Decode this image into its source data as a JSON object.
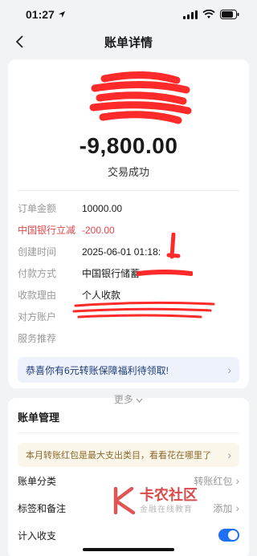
{
  "status_bar": {
    "time": "01:27"
  },
  "nav": {
    "title": "账单详情"
  },
  "summary": {
    "amount": "-9,800.00",
    "status": "交易成功"
  },
  "details": [
    {
      "label": "订单金额",
      "value": "10000.00",
      "highlight": false
    },
    {
      "label": "中国银行立减",
      "value": "-200.00",
      "highlight": true
    },
    {
      "label": "创建时间",
      "value": "2025-06-01 01:18:",
      "highlight": false
    },
    {
      "label": "付款方式",
      "value": "中国银行储蓄",
      "highlight": false
    },
    {
      "label": "收款理由",
      "value": "个人收款",
      "highlight": false
    },
    {
      "label": "对方账户",
      "value": "",
      "highlight": false
    },
    {
      "label": "服务推荐",
      "value": "",
      "highlight": false
    }
  ],
  "promo": {
    "text": "恭喜你有6元转账保障福利待领取!"
  },
  "more": {
    "label": "更多"
  },
  "management": {
    "title": "账单管理",
    "tip": "本月转账红包是最大支出类目，看看花在哪里了",
    "rows": [
      {
        "label": "账单分类",
        "value": "转账红包"
      },
      {
        "label": "标签和备注",
        "value": "添加"
      },
      {
        "label": "计入收支",
        "value": ""
      }
    ]
  },
  "watermark": {
    "line1": "卡农社区",
    "line2": "金融在线教育"
  },
  "colors": {
    "accent": "#1e6ff1",
    "red": "#e0474c",
    "scribble": "#ff2a2a"
  }
}
